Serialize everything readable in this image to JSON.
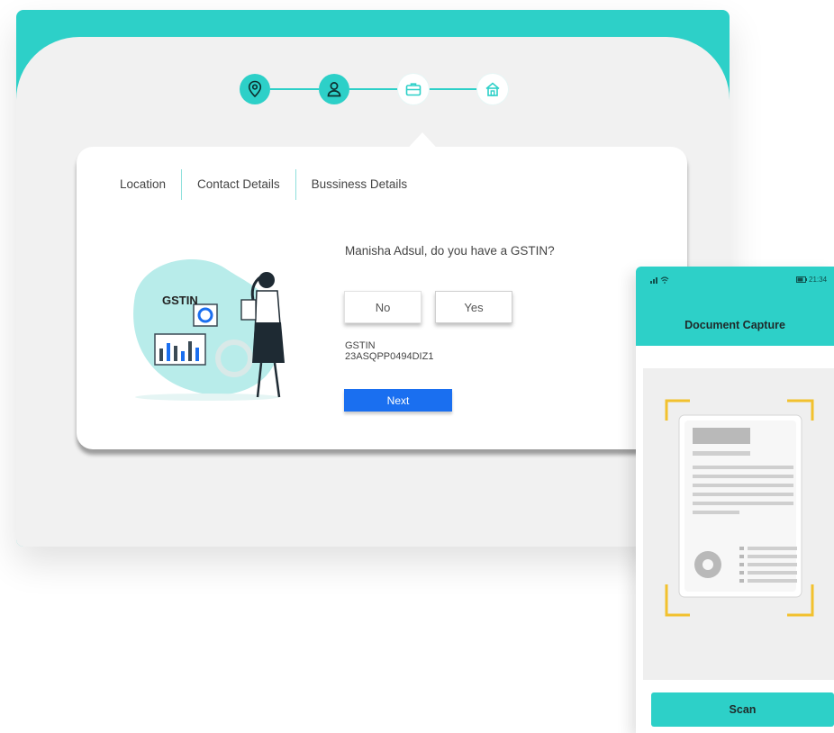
{
  "stepper": {
    "steps": [
      {
        "icon": "location-pin-icon",
        "state": "done"
      },
      {
        "icon": "user-icon",
        "state": "done"
      },
      {
        "icon": "briefcase-icon",
        "state": "current"
      },
      {
        "icon": "home-icon",
        "state": "todo"
      }
    ]
  },
  "card": {
    "tabs": [
      "Location",
      "Contact Details",
      "Bussiness Details"
    ],
    "question": "Manisha Adsul, do you have a GSTIN?",
    "no_label": "No",
    "yes_label": "Yes",
    "gstin_label": "GSTIN",
    "gstin_value": "23ASQPP0494DIZ1",
    "next_label": "Next",
    "illustration_text": "GSTIN"
  },
  "phone": {
    "status_time": "21:34",
    "title": "Document Capture",
    "scan_label": "Scan"
  },
  "colors": {
    "accent": "#2dd0c8",
    "primary_button": "#1a6ff0",
    "frame_corner": "#f2c12e",
    "background": "#f1f1f1"
  }
}
